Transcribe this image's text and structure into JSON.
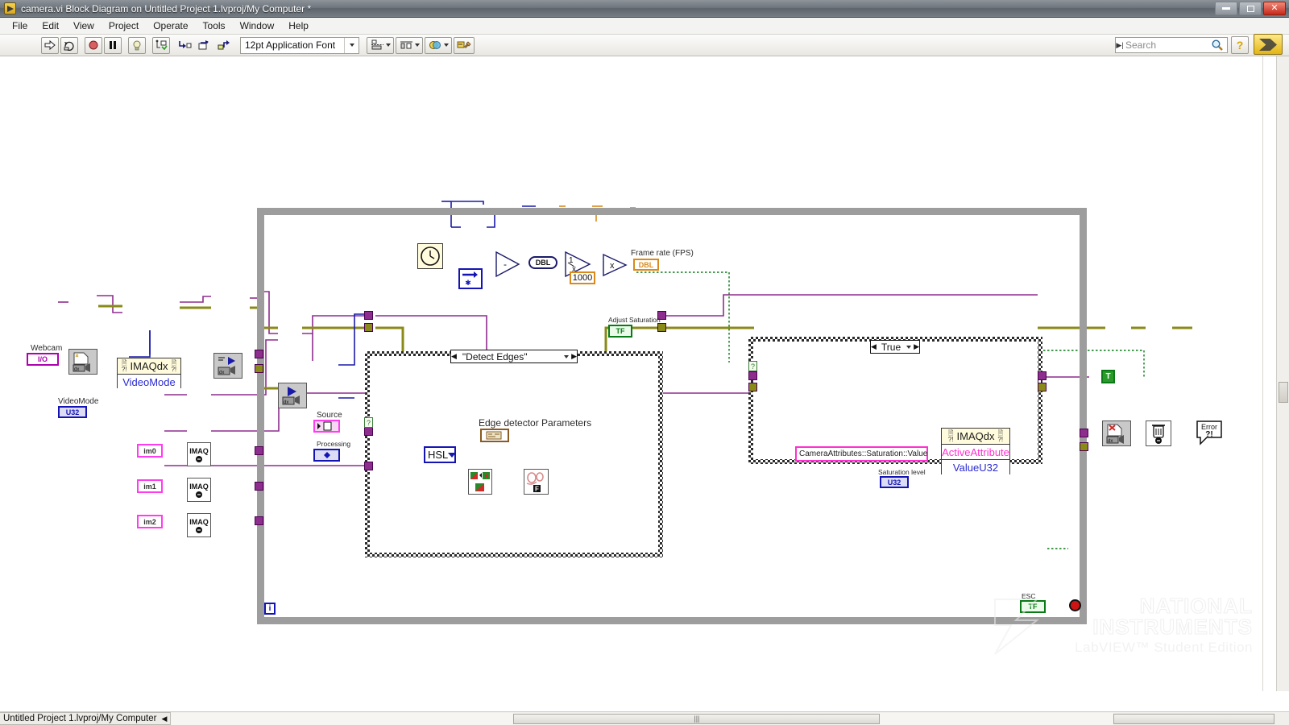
{
  "window": {
    "title": "camera.vi Block Diagram on Untitled Project 1.lvproj/My Computer *",
    "app_icon": "labview-vi-icon",
    "minimize_label": "Minimize",
    "maximize_label": "Maximize",
    "close_label": "Close"
  },
  "menu": {
    "items": [
      {
        "label": "File"
      },
      {
        "label": "Edit"
      },
      {
        "label": "View"
      },
      {
        "label": "Project"
      },
      {
        "label": "Operate"
      },
      {
        "label": "Tools"
      },
      {
        "label": "Window"
      },
      {
        "label": "Help"
      }
    ]
  },
  "toolbar": {
    "run_label": "Run",
    "run_continuously_label": "Run Continuously",
    "abort_label": "Abort Execution",
    "pause_label": "Pause",
    "highlight_label": "Highlight Execution",
    "retain_values_label": "Retain Wire Values",
    "step_into_label": "Step Into",
    "step_over_label": "Step Over",
    "step_out_label": "Step Out",
    "font_value": "12pt Application Font",
    "align_label": "Align Objects",
    "distribute_label": "Distribute Objects",
    "reorder_label": "Reorder",
    "cleanup_label": "Clean Up Diagram",
    "help_label": "?"
  },
  "search": {
    "placeholder": "Search",
    "icon": "search-icon"
  },
  "statusbar": {
    "project_path": "Untitled Project 1.lvproj/My Computer",
    "grip": "|||"
  },
  "watermark": {
    "line1": "NATIONAL",
    "line2": "INSTRUMENTS",
    "line3": "LabVIEW™ Student Edition"
  },
  "diagram": {
    "loop": {
      "iteration_label": "i",
      "stop_control_label": "ESC",
      "stop_control_value": "TF"
    },
    "timing": {
      "tick_count_label": "Tick Count (ms)",
      "subtract_label": "-",
      "coerce_label": "DBL",
      "reciprocal_label": "1/x",
      "multiply_label": "x",
      "constant_1000": "1000",
      "frame_rate_label": "Frame rate (FPS)",
      "frame_rate_type": "DBL"
    },
    "camera": {
      "webcam_label": "Webcam",
      "webcam_type": "I/O",
      "open_camera_label": "IMAQdx Open Camera",
      "property_node_label": "IMAQdx",
      "property_row": "VideoMode",
      "videomode_label": "VideoMode",
      "videomode_type": "U32",
      "configure_grab_label": "IMAQdx Configure Grab",
      "grab_label": "IMAQdx Grab",
      "close_label": "IMAQdx Close Camera",
      "dispose_label": "IMAQ Dispose",
      "error_handler_label": "Simple Error Handler"
    },
    "images": [
      {
        "label": "im0",
        "node": "IMAQ Create"
      },
      {
        "label": "im1",
        "node": "IMAQ Create"
      },
      {
        "label": "im2",
        "node": "IMAQ Create"
      }
    ],
    "controls": {
      "source_label": "Source",
      "processing_label": "Processing",
      "adjust_saturation_label": "Adjust Saturation",
      "adjust_saturation_value": "TF",
      "process_label": "Process",
      "saturation_level_label": "Saturation level",
      "saturation_level_type": "U32",
      "true_constant": "T"
    },
    "edge_case": {
      "selector_value": "\"Detect Edges\"",
      "edge_params_label": "Edge detector Parameters",
      "color_plane_value": "HSL",
      "extract_node_label": "IMAQ ExtractSingleColorPlane",
      "edge_detect_node_label": "IMAQ EdgeDetection"
    },
    "saturation_case": {
      "selector_value": "True",
      "attribute_string": "CameraAttributes::Saturation::Value",
      "property_node_label": "IMAQdx",
      "property_row_1": "ActiveAttribute",
      "property_row_2": "ValueU32"
    }
  },
  "colors": {
    "wire_image": "#8d2d8d",
    "wire_error": "#8a8a18",
    "wire_numeric_blue": "#1a1aa8",
    "wire_numeric_orange": "#d98a1a",
    "wire_bool": "#0a7a16",
    "structure_gray": "#9d9d9d",
    "node_yellow": "#fffbdc",
    "accent_pink": "#ff2fd0"
  }
}
